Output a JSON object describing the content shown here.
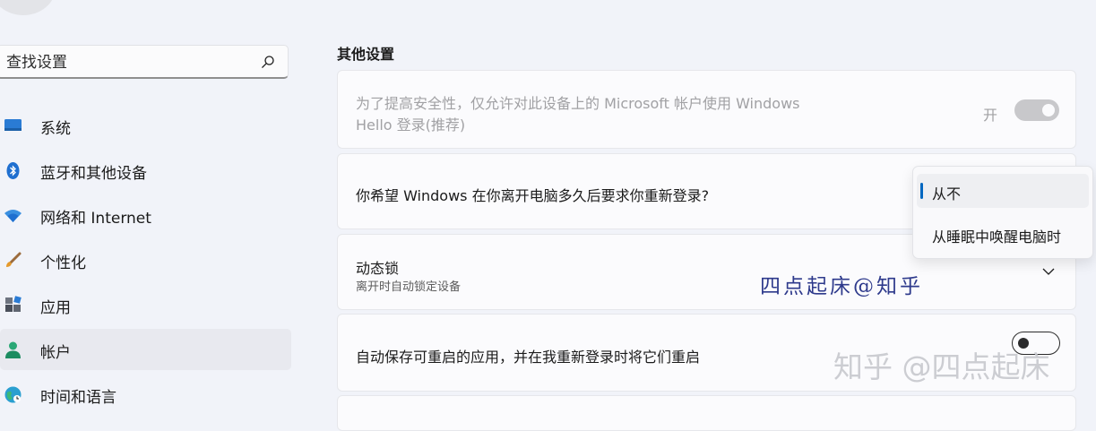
{
  "search": {
    "placeholder": "查找设置"
  },
  "nav": {
    "items": [
      {
        "label": "系统",
        "icon": "monitor-icon"
      },
      {
        "label": "蓝牙和其他设备",
        "icon": "bluetooth-icon"
      },
      {
        "label": "网络和 Internet",
        "icon": "wifi-icon"
      },
      {
        "label": "个性化",
        "icon": "brush-icon"
      },
      {
        "label": "应用",
        "icon": "apps-icon"
      },
      {
        "label": "帐户",
        "icon": "person-icon",
        "active": true
      },
      {
        "label": "时间和语言",
        "icon": "globe-icon"
      }
    ]
  },
  "main": {
    "section_title": "其他设置",
    "hello_only": {
      "text_line1": "为了提高安全性，仅允许对此设备上的 Microsoft 帐户使用 Windows",
      "text_line2": "Hello 登录(推荐)",
      "state_label": "开",
      "on": true,
      "disabled": true
    },
    "require_signin": {
      "text": "你希望 Windows 在你离开电脑多久后要求你重新登录?",
      "options": [
        "从不",
        "从睡眠中唤醒电脑时"
      ],
      "selected": "从不"
    },
    "dynamic_lock": {
      "title": "动态锁",
      "subtitle": "离开时自动锁定设备"
    },
    "restart_apps": {
      "text": "自动保存可重启的应用，并在我重新登录时将它们重启",
      "on": false
    }
  },
  "overlays": {
    "signature": "四点起床@知乎",
    "watermark": "知乎 @四点起床"
  },
  "colors": {
    "accent": "#0067c0",
    "background": "#f1f3f9",
    "card": "#fbfbfd"
  }
}
